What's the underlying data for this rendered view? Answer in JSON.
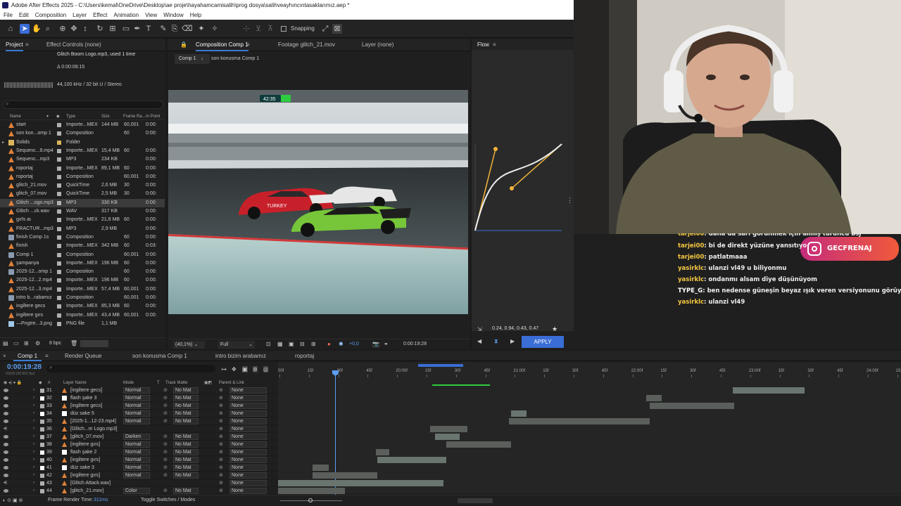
{
  "window": {
    "title": "Adobe After Effects 2025 - C:\\Users\\kemal\\OneDrive\\Desktop\\ae proje\\hayahamcamisalih\\prog dosya\\salihveayhıncıntasaklarımız.aep *"
  },
  "menu": [
    "File",
    "Edit",
    "Composition",
    "Layer",
    "Effect",
    "Animation",
    "View",
    "Window",
    "Help"
  ],
  "toolbar": {
    "snapping_label": "Snapping"
  },
  "project_panel": {
    "tab_project": "Project",
    "tab_effect_controls": "Effect Controls (none)",
    "selected_name": "Glitch Boom Logo.mp3",
    "selected_used": ", used 1 time",
    "selected_duration": "Δ 0:00:08:15",
    "selected_audio": "44,100 kHz / 32 bit U / Stereo",
    "columns": [
      "Name",
      "Type",
      "Size",
      "Frame Ra...",
      "In Point"
    ],
    "depth_label": "8 bpc",
    "items": [
      {
        "name": "start",
        "icon": "import",
        "label": "#b0b0b0",
        "type": "Importe...MEX",
        "size": "144 MB",
        "fps": "60,001",
        "in": "0:00:"
      },
      {
        "name": "son kon...omp 1",
        "icon": "import",
        "label": "#b0b0b0",
        "type": "Composition",
        "size": "",
        "fps": "60",
        "in": "0:00:"
      },
      {
        "name": "Solids",
        "icon": "folder",
        "label": "#d9b45a",
        "type": "Folder",
        "size": "",
        "fps": "",
        "in": ""
      },
      {
        "name": "Sequenc...9.mp4",
        "icon": "import",
        "label": "#b0b0b0",
        "type": "Importe...MEX",
        "size": "15,4 MB",
        "fps": "60",
        "in": "0:00:"
      },
      {
        "name": "Sequenc...mp3",
        "icon": "import",
        "label": "#b0b0b0",
        "type": "MP3",
        "size": "234 KB",
        "fps": "",
        "in": "0:00:"
      },
      {
        "name": "roportaj",
        "icon": "import",
        "label": "#b0b0b0",
        "type": "Importe...MEX",
        "size": "89,1 MB",
        "fps": "60",
        "in": "0:00:"
      },
      {
        "name": "roportaj",
        "icon": "import",
        "label": "#b0b0b0",
        "type": "Composition",
        "size": "",
        "fps": "60,001",
        "in": "0:00:"
      },
      {
        "name": "glitch_21.mov",
        "icon": "import",
        "label": "#b0b0b0",
        "type": "QuickTime",
        "size": "2,6 MB",
        "fps": "30",
        "in": "0:00:"
      },
      {
        "name": "glitch_07.mov",
        "icon": "import",
        "label": "#b0b0b0",
        "type": "QuickTime",
        "size": "2,5 MB",
        "fps": "30",
        "in": "0:00:"
      },
      {
        "name": "Glitch ...ogo.mp3",
        "icon": "import",
        "label": "#b0b0b0",
        "type": "MP3",
        "size": "330 KB",
        "fps": "",
        "in": "0:00:"
      },
      {
        "name": "Glitch ...ck.wav",
        "icon": "wav",
        "label": "#b0b0b0",
        "type": "WAV",
        "size": "317 KB",
        "fps": "",
        "in": "0:00:"
      },
      {
        "name": "gırls aı",
        "icon": "import",
        "label": "#b0b0b0",
        "type": "Importe...MEX",
        "size": "21,8 MB",
        "fps": "60",
        "in": "0:00:"
      },
      {
        "name": "FRACTUR...mp3",
        "icon": "import",
        "label": "#b0b0b0",
        "type": "MP3",
        "size": "2,9 MB",
        "fps": "",
        "in": "0:00:"
      },
      {
        "name": "finish Comp 1s",
        "icon": "comp",
        "label": "#b0b0b0",
        "type": "Composition",
        "size": "",
        "fps": "60",
        "in": "0:00:"
      },
      {
        "name": "finish",
        "icon": "import",
        "label": "#b0b0b0",
        "type": "Importe...MEX",
        "size": "342 MB",
        "fps": "60",
        "in": "0:03:"
      },
      {
        "name": "Comp 1",
        "icon": "comp",
        "label": "#b0b0b0",
        "type": "Composition",
        "size": "",
        "fps": "60,001",
        "in": "0:00:"
      },
      {
        "name": "şampanya",
        "icon": "import",
        "label": "#b0b0b0",
        "type": "Importe...MEX",
        "size": "196 MB",
        "fps": "60",
        "in": "0:00:"
      },
      {
        "name": "2025-12...omp 1",
        "icon": "comp",
        "label": "#b0b0b0",
        "type": "Composition",
        "size": "",
        "fps": "60",
        "in": "0:00:"
      },
      {
        "name": "2025-12...2.mp4",
        "icon": "import",
        "label": "#b0b0b0",
        "type": "Importe...MEX",
        "size": "196 MB",
        "fps": "60",
        "in": "0:00:"
      },
      {
        "name": "2025-12...3.mp4",
        "icon": "import",
        "label": "#b0b0b0",
        "type": "Importe...MEX",
        "size": "57,4 MB",
        "fps": "60,001",
        "in": "0:00:"
      },
      {
        "name": "intro b...rabamız",
        "icon": "comp",
        "label": "#b0b0b0",
        "type": "Composition",
        "size": "",
        "fps": "60,001",
        "in": "0:00:"
      },
      {
        "name": "ingiltere gecs",
        "icon": "import",
        "label": "#b0b0b0",
        "type": "Importe...MEX",
        "size": "85,3 MB",
        "fps": "60",
        "in": "0:00:"
      },
      {
        "name": "ingiltere gırs",
        "icon": "import",
        "label": "#b0b0b0",
        "type": "Importe...MEX",
        "size": "43,4 MB",
        "fps": "60,001",
        "in": "0:00:"
      },
      {
        "name": "—Pngtre...3.png",
        "icon": "png",
        "label": "#b0b0b0",
        "type": "PNG file",
        "size": "1,1 MB",
        "fps": "",
        "in": ""
      }
    ]
  },
  "viewer": {
    "tab_composition": "Composition Comp 1",
    "tab_footage": "Footage glitch_21.mov",
    "tab_layer": "Layer (none)",
    "crumb_1": "Comp 1",
    "crumb_2": "son konusma Comp 1",
    "hud_time": "42:35",
    "zoom": "(40,1%)",
    "resolution": "Full",
    "exposure": "+0,0",
    "timecode": "0:00:19:28"
  },
  "flow_panel": {
    "title": "Flow",
    "values": "0.24, 0.94, 0.43, 0.47",
    "apply_label": "APPLY"
  },
  "chat": [
    {
      "user": "tarjei00",
      "text": ": dana da sarı görünmek için almış turuncu bsj",
      "color": "yellow"
    },
    {
      "user": "tarjei00",
      "text": ": bi de direkt yüzüne yansıtıyo",
      "color": "yellow"
    },
    {
      "user": "tarjei00",
      "text": ": patlatmaaa",
      "color": "yellow"
    },
    {
      "user": "yasirklc",
      "text": ": ulanzi vl49 u biliyonmu",
      "color": "yellow"
    },
    {
      "user": "yasirklc",
      "text": ": ondanmı alsam diye düşünüyom",
      "color": "yellow"
    },
    {
      "user": "TYPE_G",
      "text": ": ben nedense güneşin beyaz ışık veren versiyonunu görüyorum sanki",
      "color": "white"
    },
    {
      "user": "yasirklc",
      "text": ": ulanzi vl49",
      "color": "yellow"
    }
  ],
  "instagram_handle": "GECFRENAJ",
  "timeline": {
    "tabs": [
      "Comp 1",
      "Render Queue",
      "son konusma Comp 1",
      "intro bizim arabamız",
      "roportaj"
    ],
    "timecode": "0:00:19:28",
    "timecode_sub": "01169 (60.001 fps)",
    "columns": {
      "layer_name": "Layer Name",
      "mode": "Mode",
      "t": "T",
      "track_matte": "Track Matte",
      "parent": "Parent & Link"
    },
    "ruler": [
      "00f",
      "15f",
      "30f",
      "45f",
      "20:00f",
      "15f",
      "30f",
      "45f",
      "21:00f",
      "15f",
      "30f",
      "45f",
      "22:00f",
      "15f",
      "30f",
      "45f",
      "23:00f",
      "15f",
      "30f",
      "45f",
      "24:00f",
      "15f"
    ],
    "footer_render": "Frame Render Time:",
    "footer_render_value": "311ms",
    "footer_toggle": "Toggle Switches / Modes",
    "layers": [
      {
        "num": "31",
        "name": "[ingiltere gecs]",
        "mode": "Normal",
        "matte": "No Mat",
        "parent": "None",
        "sw": "#b0b0b0",
        "bar": [
          1041,
          1143
        ]
      },
      {
        "num": "32",
        "name": "flash şake 3",
        "mode": "Normal",
        "matte": "No Mat",
        "parent": "None",
        "sw": "#ffffff",
        "bar": [
          918,
          940
        ]
      },
      {
        "num": "33",
        "name": "[ingiltere gecs]",
        "mode": "Normal",
        "matte": "No Mat",
        "parent": "None",
        "sw": "#b0b0b0",
        "bar": [
          923,
          1043
        ]
      },
      {
        "num": "34",
        "name": "düz sake 5",
        "mode": "Normal",
        "matte": "No Mat",
        "parent": "None",
        "sw": "#ffffff",
        "bar": [
          726,
          748
        ]
      },
      {
        "num": "35",
        "name": "[2025-1...12-23.mp4]",
        "mode": "Normal",
        "matte": "No Mat",
        "parent": "None",
        "sw": "#b0b0b0",
        "bar": [
          723,
          923
        ]
      },
      {
        "num": "36",
        "name": "[Glitch...m Logo.mp3]",
        "mode": "",
        "matte": "",
        "parent": "None",
        "sw": "#b0b0b0",
        "bar": [
          611,
          664
        ]
      },
      {
        "num": "37",
        "name": "[glitch_07.mov]",
        "mode": "Darken",
        "matte": "No Mat",
        "parent": "None",
        "sw": "#b0b0b0",
        "bar": [
          618,
          653
        ]
      },
      {
        "num": "38",
        "name": "[ingiltere gırs]",
        "mode": "Normal",
        "matte": "No Mat",
        "parent": "None",
        "sw": "#b0b0b0",
        "bar": [
          634,
          726
        ]
      },
      {
        "num": "39",
        "name": "flash şake 2",
        "mode": "Normal",
        "matte": "No Mat",
        "parent": "None",
        "sw": "#ffffff",
        "bar": [
          534,
          553
        ]
      },
      {
        "num": "40",
        "name": "[ingiltere gırs]",
        "mode": "Normal",
        "matte": "No Mat",
        "parent": "None",
        "sw": "#b0b0b0",
        "bar": [
          536,
          634
        ]
      },
      {
        "num": "41",
        "name": "düz sake 3",
        "mode": "Normal",
        "matte": "No Mat",
        "parent": "None",
        "sw": "#ffffff",
        "bar": [
          444,
          467
        ]
      },
      {
        "num": "42",
        "name": "[ingiltere gırs]",
        "mode": "Normal",
        "matte": "No Mat",
        "parent": "None",
        "sw": "#b0b0b0",
        "bar": [
          444,
          536
        ]
      },
      {
        "num": "43",
        "name": "[Glitch Attack.wav]",
        "mode": "",
        "matte": "",
        "parent": "None",
        "sw": "#b0b0b0",
        "bar": [
          395,
          630
        ]
      },
      {
        "num": "44",
        "name": "[glitch_21.mov]",
        "mode": "Color",
        "matte": "No Mat",
        "parent": "None",
        "sw": "#b0b0b0",
        "bar": [
          395,
          490
        ]
      }
    ]
  }
}
